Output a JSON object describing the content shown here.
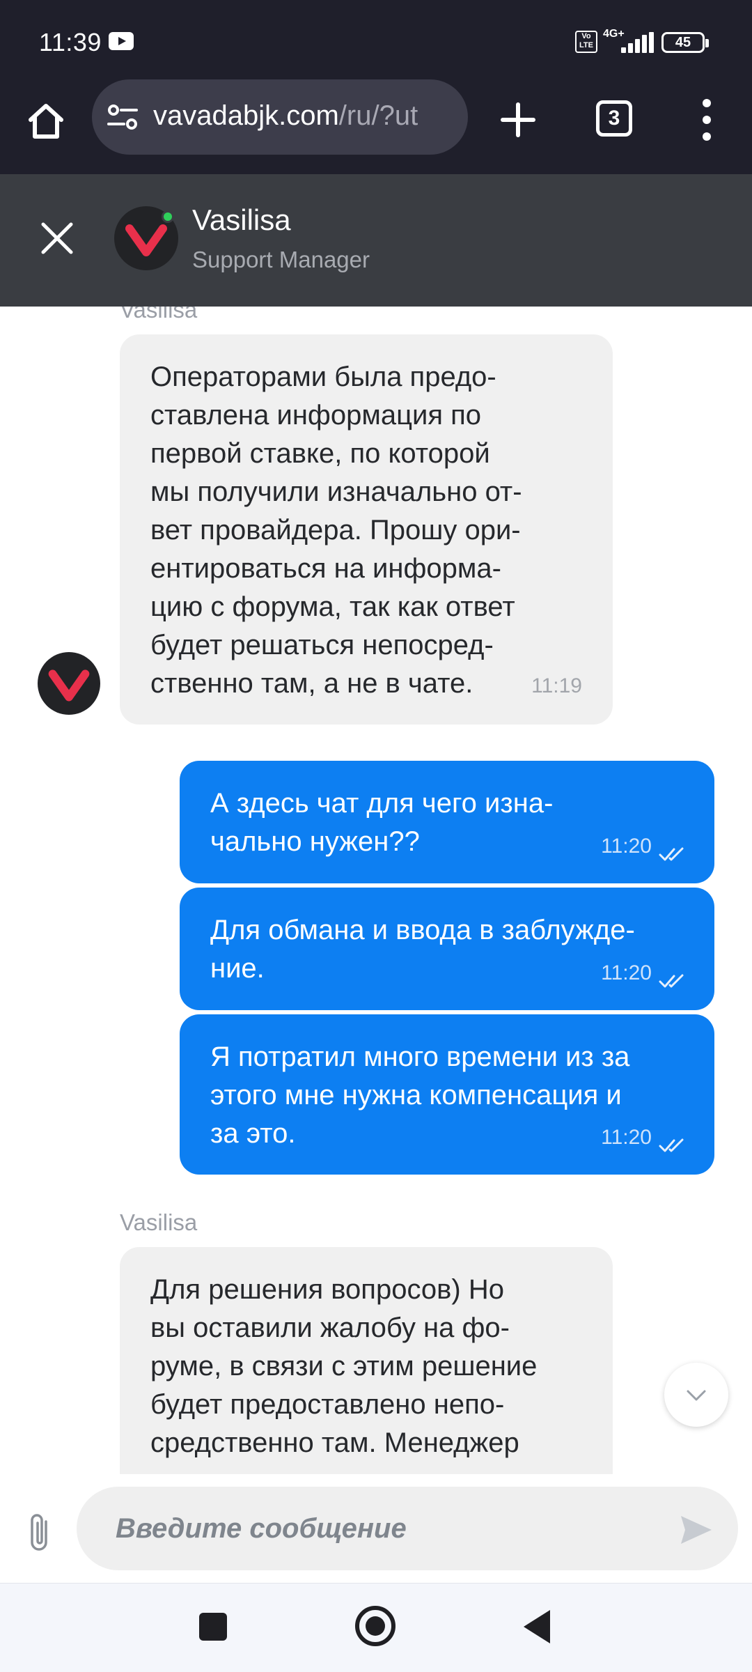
{
  "status_bar": {
    "time": "11:39",
    "volte": "Vo LTE",
    "network": "4G+",
    "battery": "45",
    "icons": [
      "youtube-notification-icon",
      "volte-icon",
      "signal-icon",
      "battery-icon"
    ]
  },
  "browser": {
    "url_domain": "vavadabjk.com",
    "url_path": "/ru/?ut",
    "tab_count": "3",
    "icons": [
      "home-icon",
      "site-settings-icon",
      "plus-icon",
      "tabs-icon",
      "more-vert-icon"
    ]
  },
  "chat_header": {
    "agent_name": "Vasilisa",
    "agent_role": "Support Manager",
    "online": true
  },
  "messages": [
    {
      "side": "in",
      "sender": "Vasilisa",
      "lines": [
        "Операторами была предо-",
        "ставлена информация по",
        "первой ставке, по которой",
        "мы получили изначально от-",
        "вет провайдера. Прошу ори-",
        "ентироваться на информа-",
        "цию с форума, так как ответ",
        "будет решаться непосред-",
        "ственно там, а не в чате."
      ],
      "time": "11:19"
    },
    {
      "side": "out",
      "lines": [
        "А здесь чат для чего изна-",
        "чально нужен??"
      ],
      "time": "11:20",
      "read": true
    },
    {
      "side": "out",
      "lines": [
        "Для обмана и ввода в заблужде-",
        "ние."
      ],
      "time": "11:20",
      "read": true
    },
    {
      "side": "out",
      "lines": [
        "Я потратил много времени из за",
        "этого мне нужна компенсация и",
        "за это."
      ],
      "time": "11:20",
      "read": true
    },
    {
      "side": "in",
      "sender": "Vasilisa",
      "lines": [
        "Для решения вопросов) Но",
        "вы оставили жалобу на фо-",
        "руме, в связи с этим решение",
        "будет предоставлено непо-",
        "средственно там. Менеджер"
      ]
    }
  ],
  "input": {
    "placeholder": "Введите сообщение"
  },
  "colors": {
    "outgoing_bubble": "#0d7ff2",
    "incoming_bubble": "#f0f0f0",
    "header_bg": "#3a3d42",
    "browser_bg": "#1f1f2b",
    "brand_red": "#e8304b",
    "online": "#2fce5a"
  }
}
